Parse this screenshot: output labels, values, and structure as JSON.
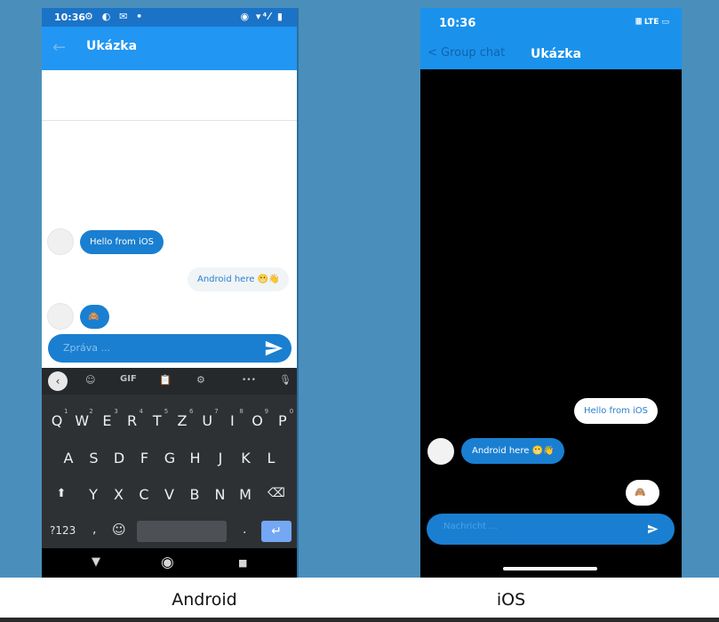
{
  "captions": {
    "android": "Android",
    "ios": "iOS"
  },
  "android": {
    "status": {
      "time": "10:36",
      "left_icons": "⚙ ◐ ✉ •",
      "right_icons": "◉ ▾⁴⁄ ▮"
    },
    "appbar": {
      "back": "←",
      "title": "Ukázka"
    },
    "messages": [
      {
        "side": "in",
        "text": "Hello from iOS"
      },
      {
        "side": "out",
        "text": "Android here 😬👋"
      },
      {
        "side": "in",
        "text": "🙈"
      }
    ],
    "input_placeholder": "Zpráva ...",
    "keyboard": {
      "toolbar": {
        "back": "‹",
        "sticker": "☺",
        "gif": "GIF",
        "clipboard": "📋",
        "settings": "⚙",
        "more": "•••",
        "mic": "🎙"
      },
      "row1": [
        "Q",
        "W",
        "E",
        "R",
        "T",
        "Z",
        "U",
        "I",
        "O",
        "P"
      ],
      "row1_digits": [
        "1",
        "2",
        "3",
        "4",
        "5",
        "6",
        "7",
        "8",
        "9",
        "0"
      ],
      "row2": [
        "A",
        "S",
        "D",
        "F",
        "G",
        "H",
        "J",
        "K",
        "L"
      ],
      "row3": [
        "Y",
        "X",
        "C",
        "V",
        "B",
        "N",
        "M"
      ],
      "shift": "⬆",
      "backspace": "⌫",
      "num_key": "?123",
      "comma": ",",
      "emoji": "☺",
      "period": ".",
      "enter": "↵"
    },
    "nav": {
      "back": "▼",
      "home": "◉",
      "recent": "■"
    }
  },
  "ios": {
    "status": {
      "time": "10:36",
      "right": "𝄃𝄃𝄃 LTE ▭"
    },
    "header": {
      "back": "< Group chat",
      "title": "Ukázka"
    },
    "messages": [
      {
        "side": "out",
        "text": "Hello from iOS"
      },
      {
        "side": "in",
        "text": "Android here 😬👋"
      },
      {
        "side": "out",
        "text": "🙈"
      }
    ],
    "input_placeholder": "Nachricht ..."
  },
  "colors": {
    "background_blue": "#4a8fbc",
    "android_appbar": "#2196f3",
    "ios_header": "#1a92ec",
    "bubble_blue": "#1a7fd1"
  }
}
